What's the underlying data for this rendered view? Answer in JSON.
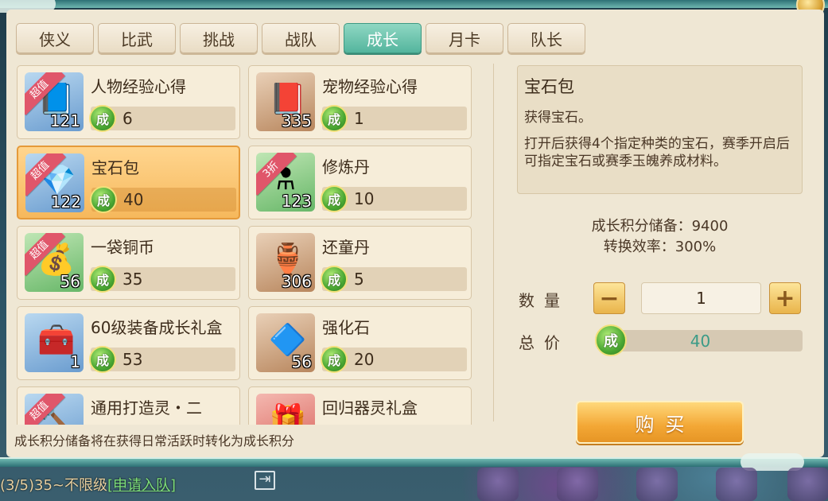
{
  "tabs": [
    {
      "label": "侠义"
    },
    {
      "label": "比武"
    },
    {
      "label": "挑战"
    },
    {
      "label": "战队"
    },
    {
      "label": "成长",
      "active": true
    },
    {
      "label": "月卡"
    },
    {
      "label": "队长"
    }
  ],
  "currency_glyph": "成",
  "items": [
    {
      "name": "人物经验心得",
      "count": "121",
      "price": "6",
      "tag": "超值",
      "icon": "blue-book-icon"
    },
    {
      "name": "宠物经验心得",
      "count": "335",
      "price": "1",
      "tag": "",
      "icon": "red-book-icon"
    },
    {
      "name": "宝石包",
      "count": "122",
      "price": "40",
      "tag": "超值",
      "icon": "gem-bag-icon",
      "selected": true
    },
    {
      "name": "修炼丹",
      "count": "123",
      "price": "10",
      "tag": "3折",
      "icon": "elixir-flask-icon"
    },
    {
      "name": "一袋铜币",
      "count": "56",
      "price": "35",
      "tag": "超值",
      "icon": "coin-bag-icon"
    },
    {
      "name": "还童丹",
      "count": "306",
      "price": "5",
      "tag": "",
      "icon": "vase-icon"
    },
    {
      "name": "60级装备成长礼盒",
      "count": "1",
      "price": "53",
      "tag": "",
      "icon": "treasure-chest-icon"
    },
    {
      "name": "强化石",
      "count": "56",
      "price": "20",
      "tag": "",
      "icon": "crystal-icon"
    },
    {
      "name": "通用打造灵・二",
      "count": "",
      "price": "",
      "tag": "超值",
      "icon": "hammer-icon"
    },
    {
      "name": "回归器灵礼盒",
      "count": "",
      "price": "",
      "tag": "",
      "icon": "gift-box-icon"
    }
  ],
  "detail": {
    "title": "宝石包",
    "subtitle": "获得宝石。",
    "description": "打开后获得4个指定种类的宝石，赛季开启后可指定宝石或赛季玉魄养成材料。"
  },
  "stats": {
    "points": "成长积分储备：9400",
    "rate": "转换效率：300%"
  },
  "purchase": {
    "quantity_label": "数量",
    "quantity": "1",
    "minus": "−",
    "plus": "+",
    "total_label": "总价",
    "total": "40",
    "buy_label": "购买"
  },
  "footer_note": "成长积分储备将在获得日常活跃时转化为成长积分",
  "chat": {
    "text": "(3/5)35~不限级",
    "link": "[申请入队]"
  }
}
